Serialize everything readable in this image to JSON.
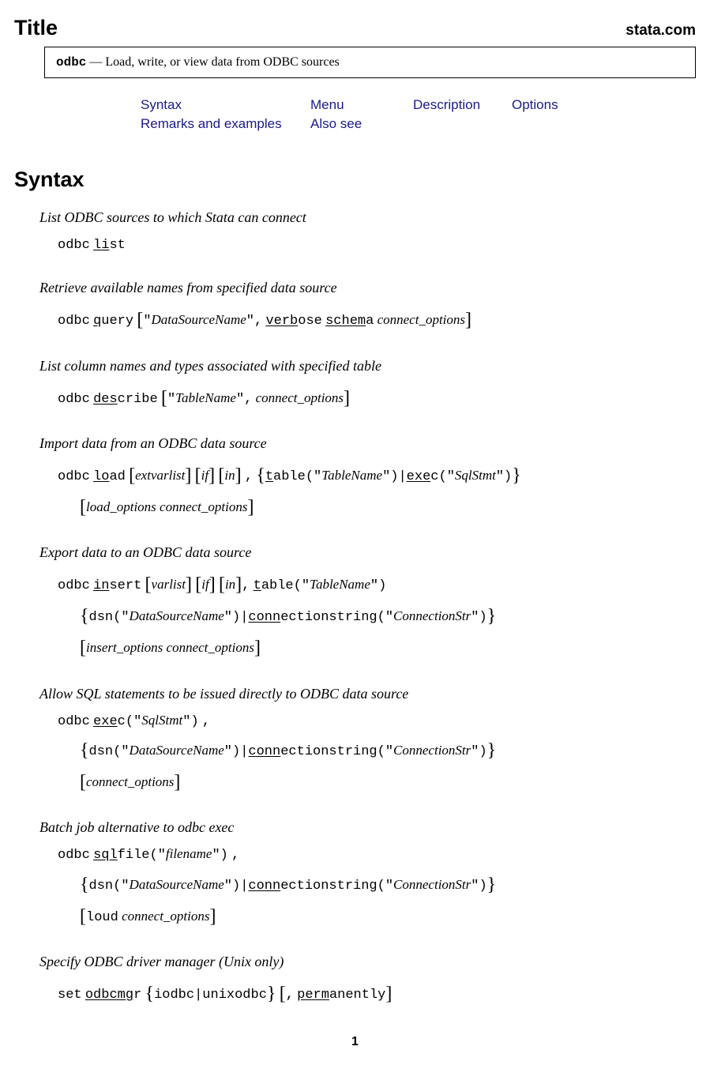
{
  "header": {
    "title": "Title",
    "site": "stata.com"
  },
  "title_box": {
    "cmd": "odbc",
    "sep": " — ",
    "desc": "Load, write, or view data from ODBC sources"
  },
  "nav": {
    "syntax": "Syntax",
    "menu": "Menu",
    "description": "Description",
    "options": "Options",
    "remarks": "Remarks and examples",
    "alsosee": "Also see"
  },
  "syntax_heading": "Syntax",
  "sections": {
    "list": {
      "desc": "List ODBC sources to which Stata can connect"
    },
    "query": {
      "desc": "Retrieve available names from specified data source"
    },
    "describe": {
      "desc": "List column names and types associated with specified table"
    },
    "load": {
      "desc": "Import data from an ODBC data source"
    },
    "insert": {
      "desc": "Export data to an ODBC data source"
    },
    "exec": {
      "desc": "Allow SQL statements to be issued directly to ODBC data source"
    },
    "sqlfile": {
      "desc": "Batch job alternative to odbc exec"
    },
    "odbcmgr": {
      "desc": "Specify ODBC driver manager (Unix only)"
    }
  },
  "tokens": {
    "odbc": "odbc",
    "list_u": "li",
    "list_r": "st",
    "query_u": "q",
    "query_r": "uery",
    "verb_u": "verb",
    "verb_r": "ose",
    "schem_u": "schem",
    "schem_r": "a",
    "des_u": "des",
    "des_r": "cribe",
    "lo_u": "lo",
    "lo_r": "ad",
    "in_u": "in",
    "in_r": "sert",
    "exe_u": "exe",
    "exe_r": "c",
    "sql_u": "sql",
    "sql_r": "file",
    "set": "set",
    "odbcmg_u": "odbcmg",
    "odbcmg_r": "r",
    "perm_u": "perm",
    "perm_r": "anently",
    "t_u": "t",
    "t_r": "able",
    "conn_u": "conn",
    "conn_r": "ectionstring",
    "dsn": "dsn",
    "loud": "loud",
    "iodbc": "iodbc",
    "unixodbc": "unixodbc",
    "DataSourceName": "DataSourceName",
    "TableName": "TableName",
    "SqlStmt": "SqlStmt",
    "ConnectionStr": "ConnectionStr",
    "filename": "filename",
    "extvarlist": "extvarlist",
    "varlist": "varlist",
    "if": "if",
    "in": "in",
    "connect_options": "connect_options",
    "load_options": "load_options",
    "insert_options": "insert_options",
    "quote": "\"",
    "comma": ",",
    "pipe": "|",
    "lparen": "(",
    "rparen": ")"
  },
  "page_num": "1"
}
